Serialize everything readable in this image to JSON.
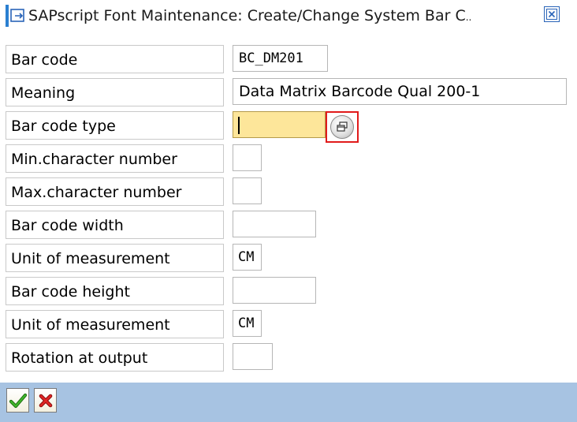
{
  "window": {
    "title": "SAPscript Font Maintenance: Create/Change System Bar C",
    "title_overflow": ".."
  },
  "fields": {
    "bar_code": {
      "label": "Bar code",
      "value": "BC_DM201"
    },
    "meaning": {
      "label": "Meaning",
      "value": "Data Matrix Barcode Qual 200-1"
    },
    "bar_code_type": {
      "label": "Bar code type",
      "value": ""
    },
    "min_char_number": {
      "label": "Min.character number",
      "value": ""
    },
    "max_char_number": {
      "label": "Max.character number",
      "value": ""
    },
    "bar_code_width": {
      "label": "Bar code width",
      "value": ""
    },
    "unit_width": {
      "label": "Unit of measurement",
      "value": "CM"
    },
    "bar_code_height": {
      "label": "Bar code height",
      "value": ""
    },
    "unit_height": {
      "label": "Unit of measurement",
      "value": "CM"
    },
    "rotation": {
      "label": "Rotation at output",
      "value": ""
    }
  },
  "icons": {
    "title": "window-icon",
    "close": "close-icon",
    "value_help": "value-help-icon",
    "confirm": "checkmark-icon",
    "cancel": "cancel-x-icon"
  },
  "colors": {
    "focused_input": "#fde69a",
    "footer": "#a7c3e2",
    "highlight_border": "#e11b1b",
    "confirm_green": "#2e9e1e",
    "cancel_red": "#d31919"
  }
}
